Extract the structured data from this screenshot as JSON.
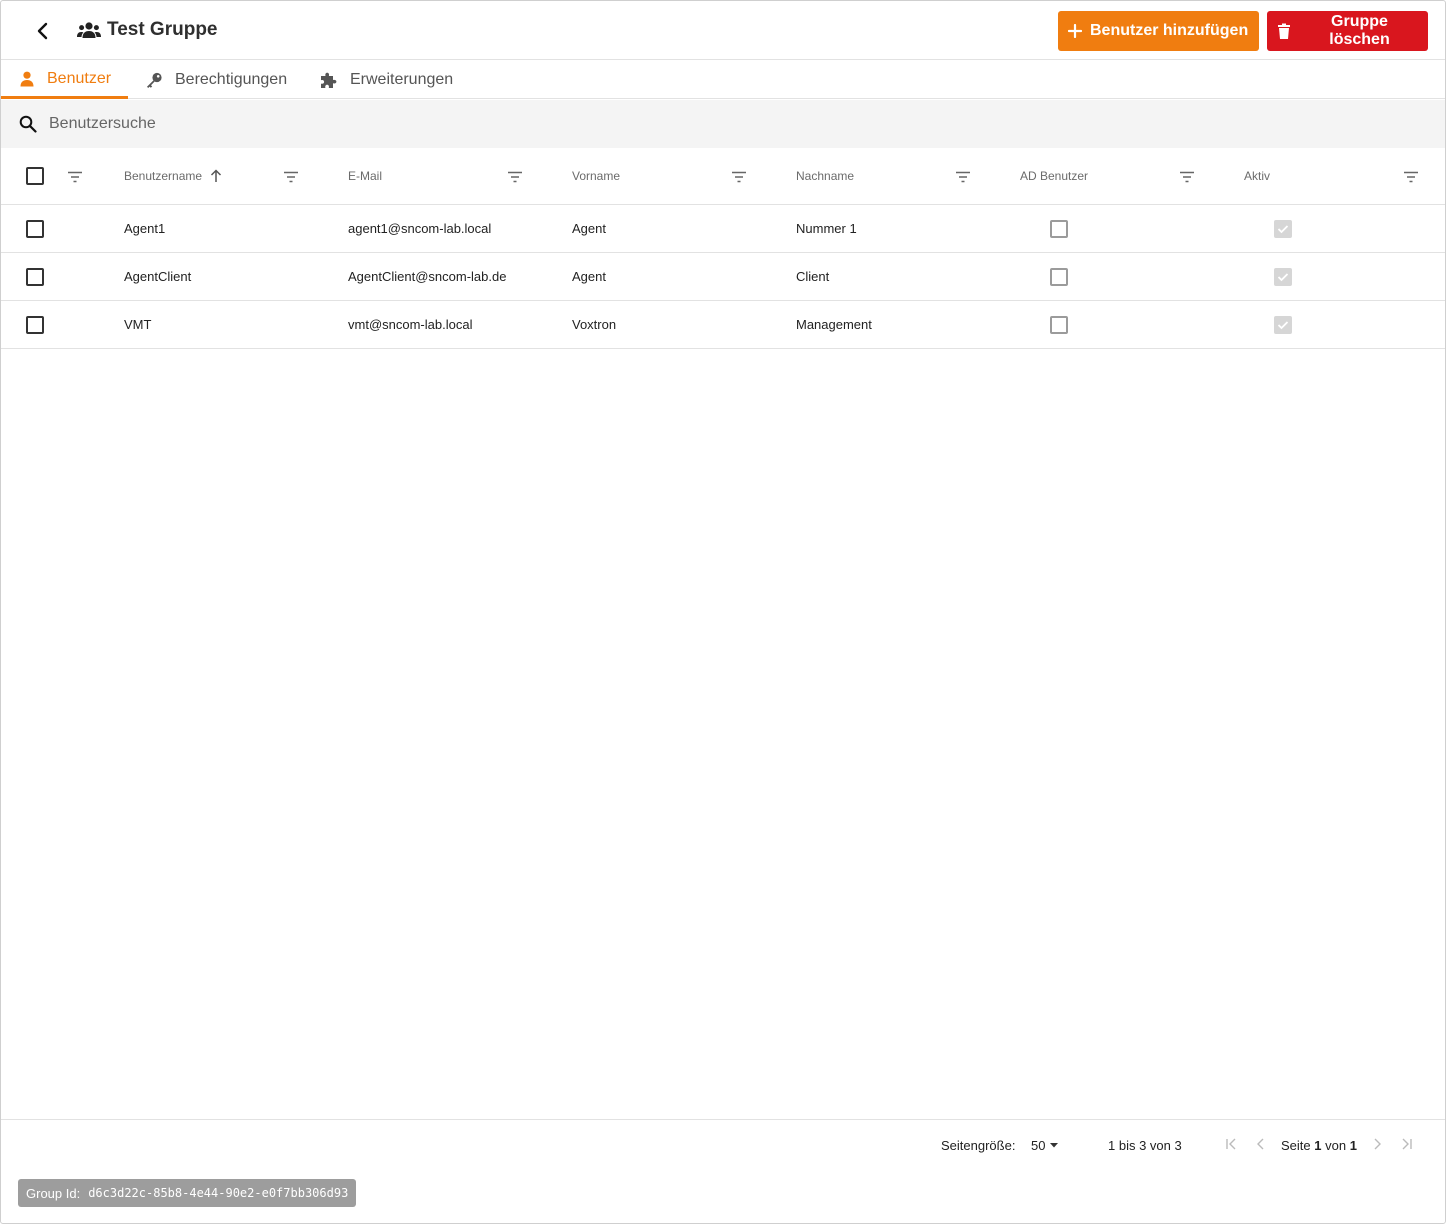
{
  "header": {
    "title": "Test Gruppe",
    "add_user_label": "Benutzer hinzufügen",
    "delete_group_label": "Gruppe löschen"
  },
  "colors": {
    "accent": "#f07d10",
    "danger": "#d9161e",
    "badge": "#9d9d9d"
  },
  "tabs": [
    {
      "label": "Benutzer",
      "icon": "person-icon",
      "active": true
    },
    {
      "label": "Berechtigungen",
      "icon": "key-icon",
      "active": false
    },
    {
      "label": "Erweiterungen",
      "icon": "puzzle-icon",
      "active": false
    }
  ],
  "search": {
    "placeholder": "Benutzersuche",
    "value": ""
  },
  "table": {
    "columns": [
      "Benutzername",
      "E-Mail",
      "Vorname",
      "Nachname",
      "AD Benutzer",
      "Aktiv"
    ],
    "sort": {
      "column": "Benutzername",
      "direction": "asc"
    },
    "rows": [
      {
        "username": "Agent1",
        "email": "agent1@sncom-lab.local",
        "firstname": "Agent",
        "lastname": "Nummer 1",
        "ad_user": false,
        "active": true
      },
      {
        "username": "AgentClient",
        "email": "AgentClient@sncom-lab.de",
        "firstname": "Agent",
        "lastname": "Client",
        "ad_user": false,
        "active": true
      },
      {
        "username": "VMT",
        "email": "vmt@sncom-lab.local",
        "firstname": "Voxtron",
        "lastname": "Management",
        "ad_user": false,
        "active": true
      }
    ]
  },
  "pagination": {
    "page_size_label": "Seitengröße:",
    "page_size": "50",
    "range_label": "1 bis 3 von 3",
    "page_prefix": "Seite",
    "page_current": "1",
    "page_sep": "von",
    "page_total": "1"
  },
  "group_id": {
    "label": "Group Id:",
    "value": "d6c3d22c-85b8-4e44-90e2-e0f7bb306d93"
  }
}
